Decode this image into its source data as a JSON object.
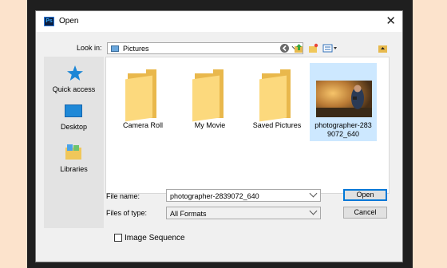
{
  "window": {
    "title": "Open",
    "app_icon": "Ps"
  },
  "look_in": {
    "label": "Look in:",
    "value": "Pictures"
  },
  "places": [
    {
      "label": "Quick access"
    },
    {
      "label": "Desktop"
    },
    {
      "label": "Libraries"
    }
  ],
  "files": [
    {
      "name": "Camera Roll",
      "type": "folder"
    },
    {
      "name": "My Movie",
      "type": "folder"
    },
    {
      "name": "Saved Pictures",
      "type": "folder"
    },
    {
      "name_line1": "photographer-283",
      "name_line2": "9072_640",
      "type": "image",
      "selected": true
    }
  ],
  "file_name": {
    "label": "File name:",
    "value": "photographer-2839072_640"
  },
  "file_type": {
    "label": "Files of type:",
    "value": "All Formats"
  },
  "buttons": {
    "open": "Open",
    "cancel": "Cancel"
  },
  "image_sequence": {
    "label": "Image Sequence",
    "checked": false
  },
  "colors": {
    "backdrop": "#fce3cc",
    "selection": "#cde8ff",
    "accent": "#0078d7",
    "folder": "#fcd97d"
  }
}
